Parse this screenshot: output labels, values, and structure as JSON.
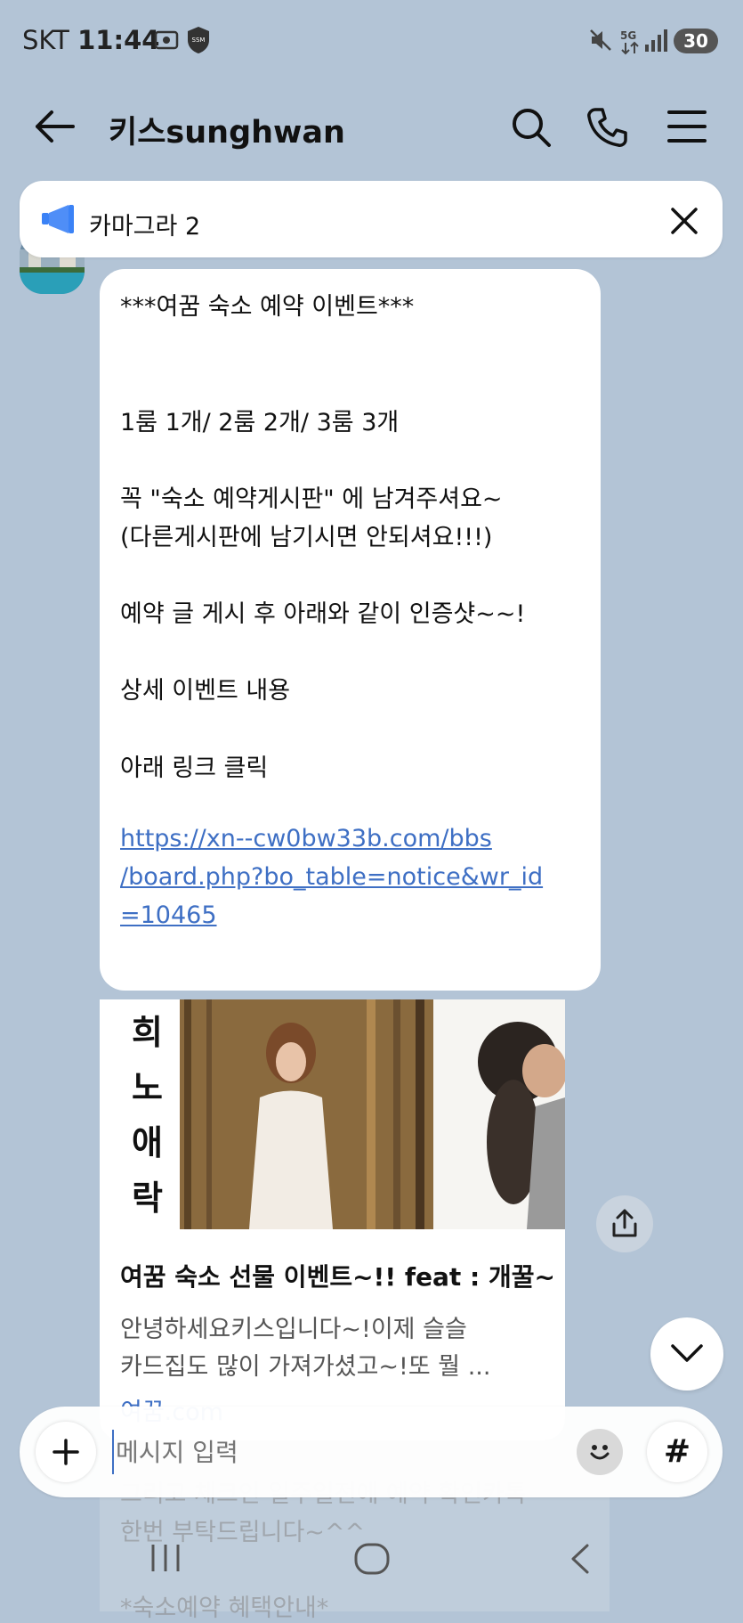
{
  "status_bar": {
    "carrier": "SKT",
    "time": "11:44",
    "battery": "30",
    "network": "5G"
  },
  "header": {
    "title": "키스sunghwan"
  },
  "notice": {
    "text": "카마그라 2"
  },
  "message": {
    "lines": [
      "***여꿈 숙소 예약 이벤트***",
      "1룸 1개/ 2룸 2개/ 3룸 3개",
      "꼭  \"숙소 예약게시판\" 에 남겨주셔요~",
      "(다른게시판에 남기시면 안되셔요!!!)",
      "예약 글 게시 후 아래와 같이 인증샷~~!",
      "상세 이벤트 내용",
      "아래 링크 클릭"
    ],
    "link_lines": [
      "https://xn--cw0bw33b.com/bbs",
      "/board.php?bo_table=notice&wr_id",
      "=10465"
    ]
  },
  "card": {
    "image_text": [
      "희",
      "노",
      "애",
      "락"
    ],
    "title": "여꿈 숙소 선물 이벤트~!! feat : 개꿀~",
    "desc_lines": [
      "안녕하세요키스입니다~!이제 슬슬",
      "카드집도 많이 가져가셨고~!또 뭘 ..."
    ],
    "domain": "여꿈.com"
  },
  "faded_lines": [
    "그리고 체크인 일주일전에 예약 확인카톡",
    "한번 부탁드립니다~^^",
    "*숙소예약 혜택안내*"
  ],
  "input": {
    "placeholder": "메시지 입력"
  },
  "colors": {
    "background": "#b3c4d6",
    "link": "#3e6fc4",
    "notice_icon": "#3b82f6"
  }
}
